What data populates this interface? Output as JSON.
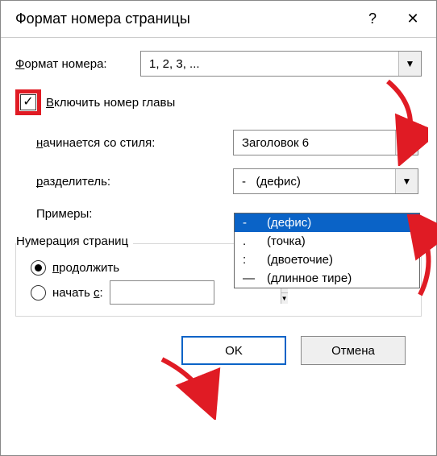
{
  "title": "Формат номера страницы",
  "format_label": "Формат номера:",
  "format_label_u": "Ф",
  "format_label_rest": "ормат номера:",
  "format_value": "1, 2, 3, ...",
  "include_chapter_checked": true,
  "include_chapter_label_u": "В",
  "include_chapter_label_rest": "ключить номер главы",
  "starts_style_label_u": "н",
  "starts_style_label_rest": "ачинается со стиля:",
  "starts_style_value": "Заголовок 6",
  "sep_label_u": "р",
  "sep_label_rest": "азделитель:",
  "sep_value_sym": "-",
  "sep_value_text": "(дефис)",
  "sep_options": [
    {
      "sym": "-",
      "text": "(дефис)"
    },
    {
      "sym": ".",
      "text": "(точка)"
    },
    {
      "sym": ":",
      "text": "(двоеточие)"
    },
    {
      "sym": "—",
      "text": "(длинное тире)"
    }
  ],
  "examples_label": "Примеры:",
  "group_label": "Нумерация страниц",
  "radio_continue_u": "п",
  "radio_continue_rest": "родолжить",
  "radio_startat_label": "начать ",
  "radio_startat_u": "с",
  "radio_startat_rest": ":",
  "startat_value": "",
  "ok": "OK",
  "cancel": "Отмена"
}
